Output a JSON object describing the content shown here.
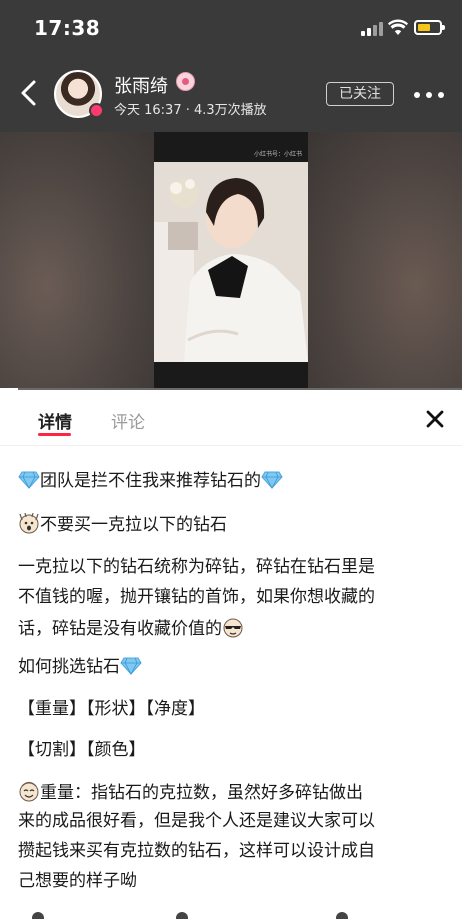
{
  "status_bar": {
    "time": "17:38",
    "battery_color": "#f5c518"
  },
  "header": {
    "username": "张雨绮",
    "meta": "今天 16:37 · 4.3万次播放",
    "follow_label": "已关注",
    "back_icon": "chevron-left-icon",
    "more_icon": "more-dots-icon"
  },
  "video": {
    "watermark": "小红书号：小红书",
    "progress": 0.04
  },
  "tabs": [
    {
      "label": "详情",
      "active": true
    },
    {
      "label": "评论",
      "active": false
    }
  ],
  "accent_color": "#ff2442",
  "post": {
    "title": "团队是拦不住我来推荐钻石的",
    "subtitle": "不要买一克拉以下的钻石",
    "paragraph1_lines": [
      "一克拉以下的钻石统称为碎钻，碎钻在钻石里是",
      "不值钱的喔，抛开镶钻的首饰，如果你想收藏的",
      "话，碎钻是没有收藏价值的"
    ],
    "how_to": "如何挑选钻石",
    "criteria_row1": "【重量】【形状】【净度】",
    "criteria_row2": "【切割】【颜色】",
    "paragraph2_lines": [
      "重量：指钻石的克拉数，虽然好多碎钻做出",
      "来的成品很好看，但是我个人还是建议大家可以",
      "攒起钱来买有克拉数的钻石，这样可以设计成自",
      "己想要的样子呦"
    ]
  }
}
